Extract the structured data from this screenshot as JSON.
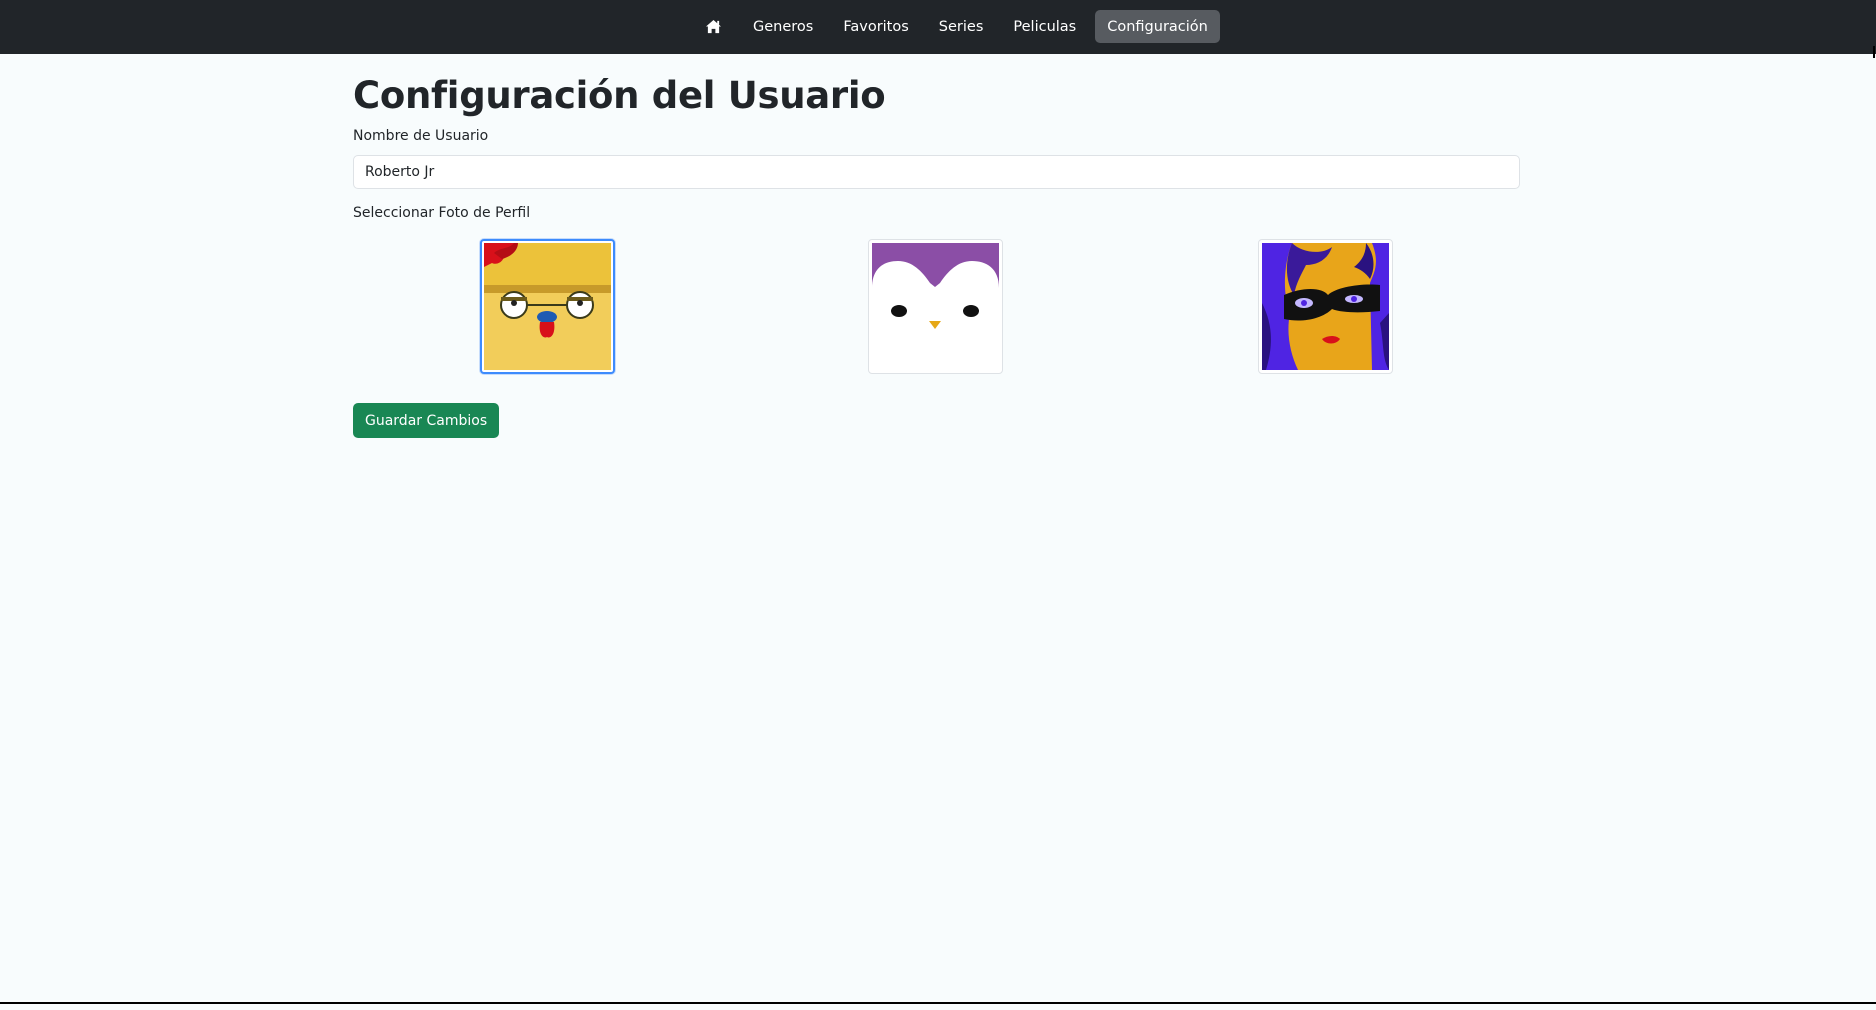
{
  "nav": {
    "home_icon": "home-icon",
    "items": [
      "Generos",
      "Favoritos",
      "Series",
      "Peliculas",
      "Configuración"
    ],
    "active": "Configuración"
  },
  "page": {
    "title": "Configuración del Usuario",
    "username_label": "Nombre de Usuario",
    "username_value": "Roberto Jr",
    "photo_label": "Seleccionar Foto de Perfil",
    "avatars": [
      {
        "name": "rooster-avatar",
        "selected": true
      },
      {
        "name": "penguin-avatar",
        "selected": false
      },
      {
        "name": "masked-woman-avatar",
        "selected": false
      }
    ],
    "save_label": "Guardar Cambios"
  },
  "colors": {
    "navbar": "#212529",
    "active_nav": "#575b60",
    "save_button": "#198754",
    "selected_border": "#3d8bfd",
    "background": "#f8fcfd"
  }
}
